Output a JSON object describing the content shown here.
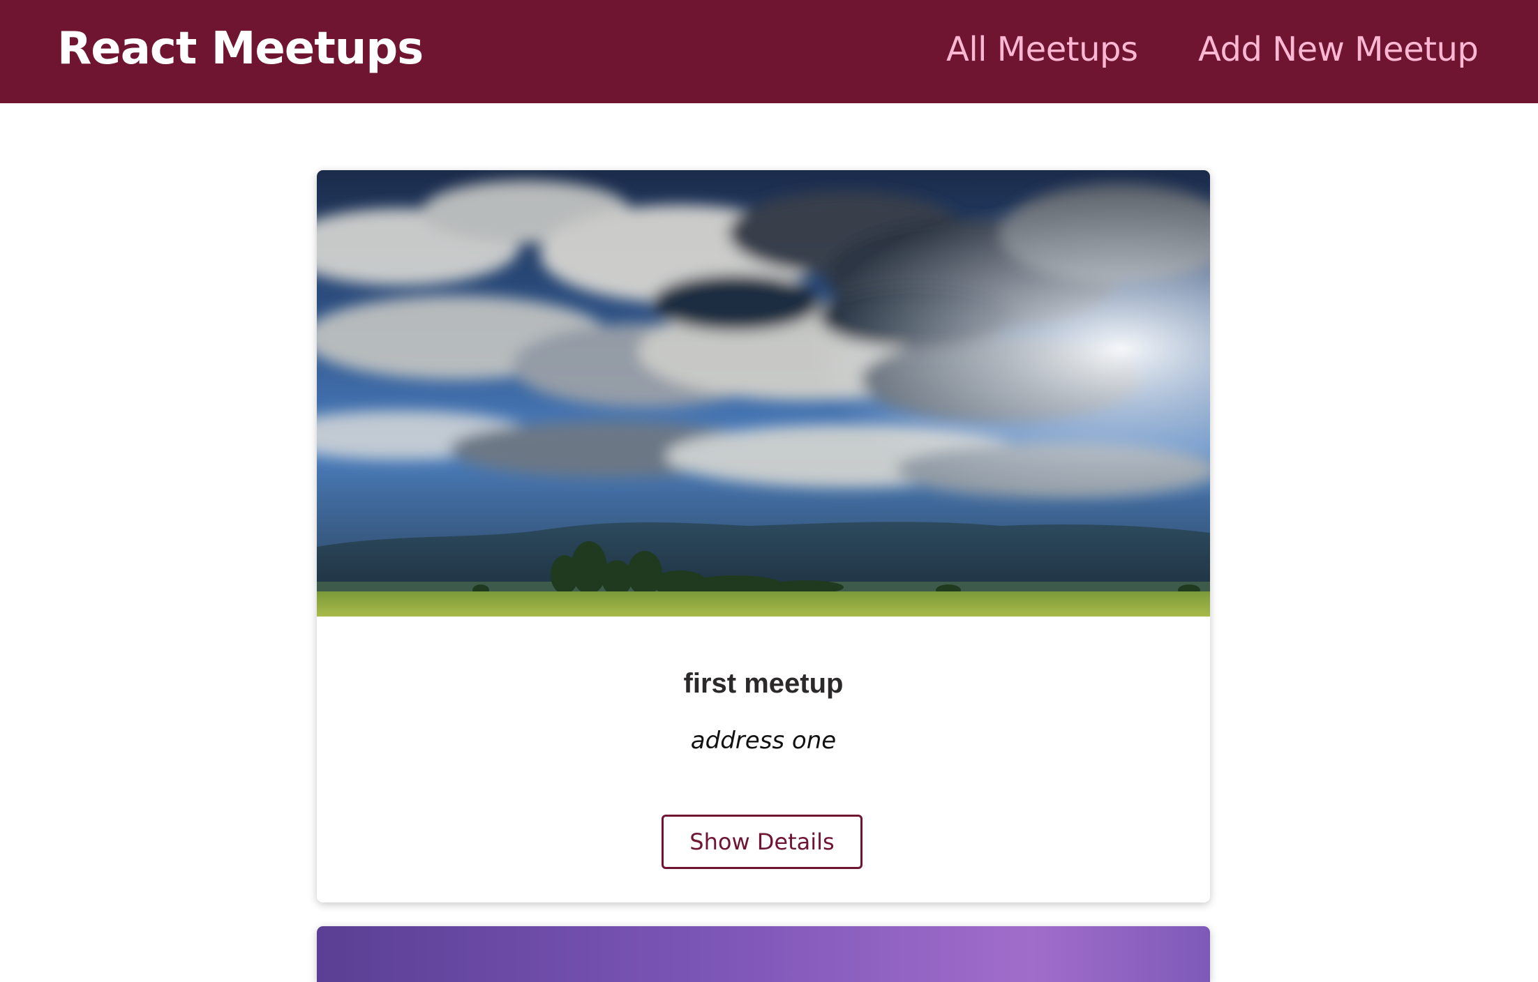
{
  "header": {
    "logo_text": "React Meetups",
    "nav": [
      {
        "label": "All Meetups"
      },
      {
        "label": "Add New Meetup"
      }
    ]
  },
  "meetups": [
    {
      "title": "first meetup",
      "address": "address one",
      "action_label": "Show Details",
      "image": "landscape-clouds-field-photo"
    },
    {
      "image": "purple-sky-photo"
    }
  ],
  "colors": {
    "header_bg": "#6f1431",
    "logo_text": "#ffffff",
    "nav_text": "#fcb8d3",
    "button_border": "#6f1431",
    "title_text": "#2c292b"
  }
}
